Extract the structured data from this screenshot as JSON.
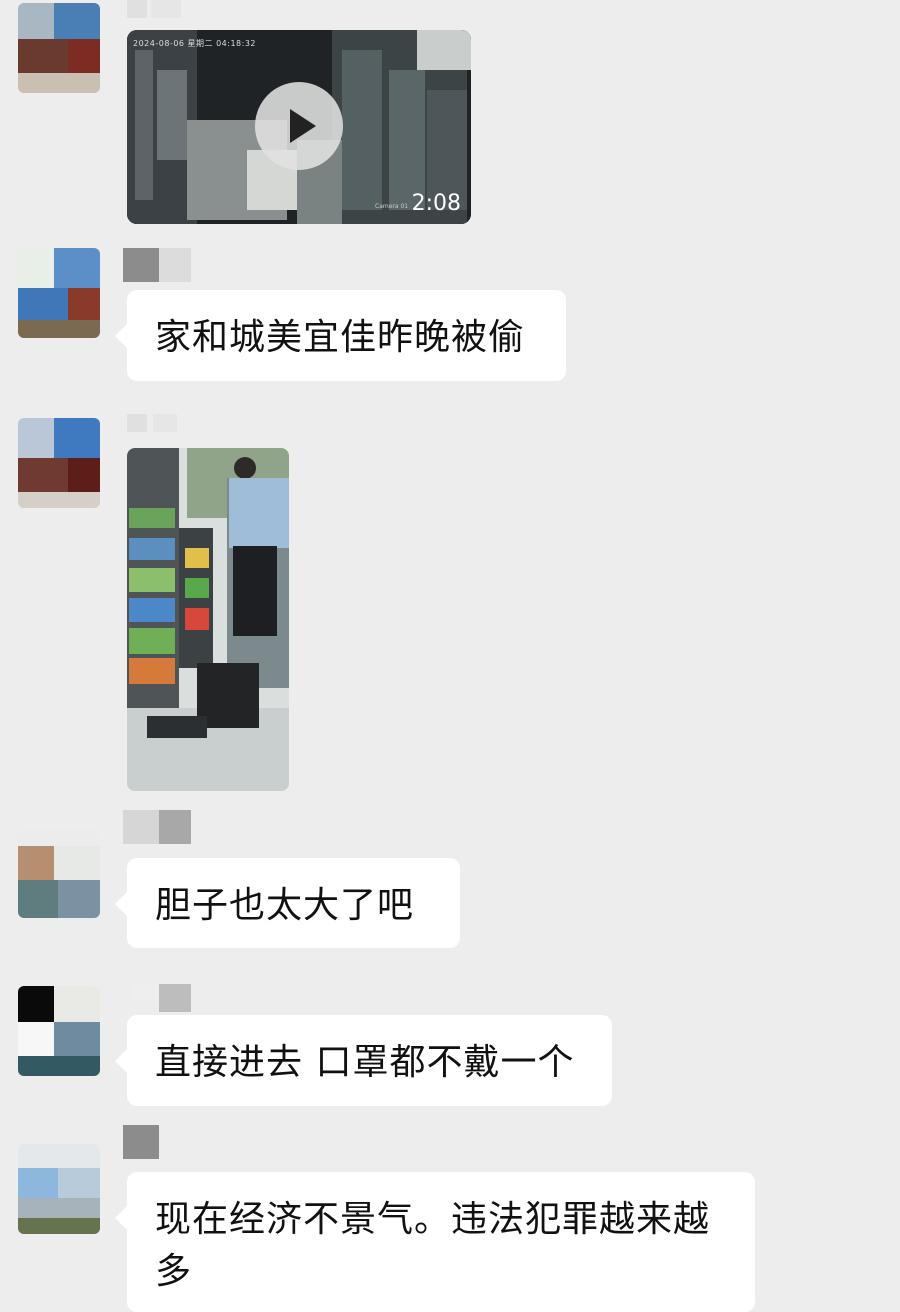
{
  "messages": [
    {
      "id": "msg-1",
      "type": "video",
      "video": {
        "duration": "2:08",
        "timestamp_overlay": "2024-08-06 星期二 04:18:32",
        "watermark": "Camera 01"
      }
    },
    {
      "id": "msg-2",
      "type": "text",
      "text": "家和城美宜佳昨晚被偷"
    },
    {
      "id": "msg-3",
      "type": "image"
    },
    {
      "id": "msg-4",
      "type": "text",
      "text": "胆子也太大了吧"
    },
    {
      "id": "msg-5",
      "type": "text",
      "text": "直接进去 口罩都不戴一个"
    },
    {
      "id": "msg-6",
      "type": "text",
      "text": "现在经济不景气。违法犯罪越来越多"
    }
  ]
}
